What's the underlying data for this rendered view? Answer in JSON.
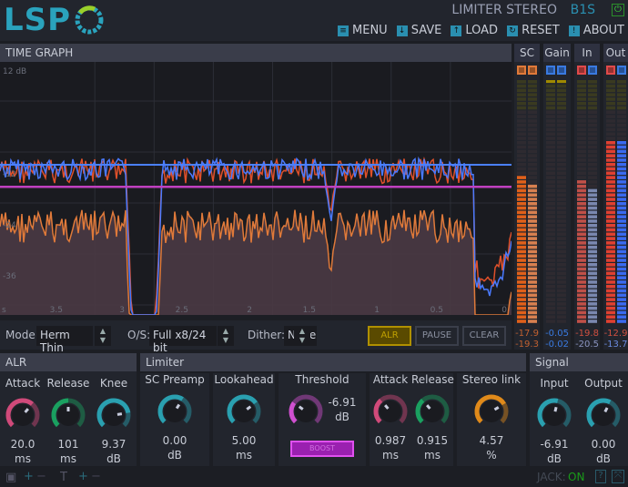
{
  "header": {
    "logo": "LSP",
    "title": "LIMITER STEREO",
    "model": "B1S",
    "power_icon": "power-icon",
    "menu": [
      {
        "label": "MENU",
        "icon": "menu-icon"
      },
      {
        "label": "SAVE",
        "icon": "save-icon"
      },
      {
        "label": "LOAD",
        "icon": "load-icon"
      },
      {
        "label": "RESET",
        "icon": "reset-icon"
      },
      {
        "label": "ABOUT",
        "icon": "about-icon"
      }
    ]
  },
  "graph": {
    "title": "TIME GRAPH",
    "y_labels": [
      "12 dB",
      "-12",
      "-24",
      "-36"
    ],
    "x_labels": [
      "s",
      "3.5",
      "3",
      "2.5",
      "2",
      "1.5",
      "1",
      "0.5",
      "0"
    ],
    "threshold_db": -6.91,
    "colors": {
      "input": "#e0502a",
      "output": "#4a7aff",
      "sc": "#e07a3a",
      "threshold": "#c040c0",
      "gain": "#4a80ff"
    }
  },
  "controls": {
    "mode_label": "Mode:",
    "mode_value": "Herm Thin",
    "os_label": "O/S:",
    "os_value": "Full x8/24 bit",
    "dither_label": "Dither:",
    "dither_value": "None",
    "alr_button": "ALR",
    "pause_button": "PAUSE",
    "clear_button": "CLEAR"
  },
  "meters": [
    {
      "label": "SC",
      "values": [
        "-17.9",
        "-19.3"
      ],
      "color": "#e07a3a",
      "levels": [
        0.6,
        0.56
      ]
    },
    {
      "label": "Gain",
      "values": [
        "-0.05",
        "-0.02"
      ],
      "color": "#3a7ae0",
      "levels": [
        0,
        0
      ]
    },
    {
      "label": "In",
      "values": [
        "-19.8",
        "-20.5"
      ],
      "color": "#e05a4a",
      "levels": [
        0.58,
        0.55
      ]
    },
    {
      "label": "Out",
      "values": [
        "-12.9",
        "-13.7"
      ],
      "color": "#e04a3a",
      "levels": [
        0.74,
        0.74
      ]
    }
  ],
  "alr": {
    "title": "ALR",
    "knobs": [
      {
        "label": "Attack",
        "value": "20.0",
        "unit": "ms",
        "color": "#d04a7a",
        "pos": 0.65
      },
      {
        "label": "Release",
        "value": "101",
        "unit": "ms",
        "color": "#1aa060",
        "pos": 0.5
      },
      {
        "label": "Knee",
        "value": "9.37",
        "unit": "dB",
        "color": "#2aa0b0",
        "pos": 0.8
      }
    ]
  },
  "limiter": {
    "title": "Limiter",
    "knobs": [
      {
        "label": "SC Preamp",
        "value": "0.00",
        "unit": "dB",
        "color": "#2aa0b0",
        "pos": 0.62
      },
      {
        "label": "Lookahead",
        "value": "5.00",
        "unit": "ms",
        "color": "#2aa0b0",
        "pos": 0.7
      },
      {
        "label": "Threshold",
        "value": "-6.91",
        "unit": "dB",
        "color": "#d050d0",
        "pos": 0.3
      },
      {
        "label": "Attack",
        "value": "0.987",
        "unit": "ms",
        "color": "#d04a7a",
        "pos": 0.35
      },
      {
        "label": "Release",
        "value": "0.915",
        "unit": "ms",
        "color": "#1aa060",
        "pos": 0.35
      },
      {
        "label": "Stereo link",
        "value": "4.57",
        "unit": "%",
        "color": "#e08a1a",
        "pos": 0.72
      }
    ],
    "boost": "BOOST"
  },
  "signal": {
    "title": "Signal",
    "knobs": [
      {
        "label": "Input",
        "value": "-6.91",
        "unit": "dB",
        "color": "#2aa0b0",
        "pos": 0.55
      },
      {
        "label": "Output",
        "value": "0.00",
        "unit": "dB",
        "color": "#2aa0b0",
        "pos": 0.6
      }
    ]
  },
  "footer": {
    "jack_label": "JACK:",
    "jack_state": "ON"
  }
}
